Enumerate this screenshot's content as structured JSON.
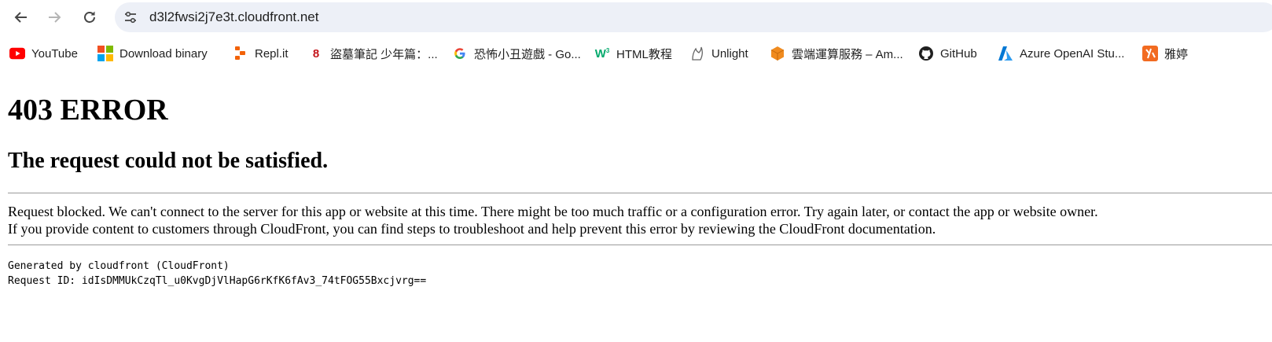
{
  "browser": {
    "url": "d3l2fwsi2j7e3t.cloudfront.net",
    "bookmarks": [
      {
        "label": "YouTube",
        "icon": "youtube-icon"
      },
      {
        "label": "Download binary",
        "icon": "windows-icon"
      },
      {
        "label": "Repl.it",
        "icon": "replit-icon"
      },
      {
        "label": "盜墓筆記 少年篇：...",
        "icon": "eight-icon"
      },
      {
        "label": "恐怖小丑遊戲 - Go...",
        "icon": "google-icon"
      },
      {
        "label": "HTML教程",
        "icon": "w3-icon"
      },
      {
        "label": "Unlight",
        "icon": "unlight-icon"
      },
      {
        "label": "雲端運算服務 – Am...",
        "icon": "aws-box-icon"
      },
      {
        "label": "GitHub",
        "icon": "github-icon"
      },
      {
        "label": "Azure OpenAI Stu...",
        "icon": "azure-icon"
      },
      {
        "label": "雅婷",
        "icon": "yating-icon"
      }
    ]
  },
  "page": {
    "title": "403 ERROR",
    "subtitle": "The request could not be satisfied.",
    "paragraph_line1": "Request blocked. We can't connect to the server for this app or website at this time. There might be too much traffic or a configuration error. Try again later, or contact the app or website owner.",
    "paragraph_line2": "If you provide content to customers through CloudFront, you can find steps to troubleshoot and help prevent this error by reviewing the CloudFront documentation.",
    "generated_by": "Generated by cloudfront (CloudFront)",
    "request_id": "Request ID: idIsDMMUkCzqTl_u0KvgDjVlHapG6rKfK6fAv3_74tFOG55Bxcjvrg=="
  },
  "colors": {
    "omnibox_bg": "#edf0f7",
    "youtube_red": "#ff0000",
    "aws_orange": "#f08b1f",
    "azure_blue": "#0078d4"
  }
}
